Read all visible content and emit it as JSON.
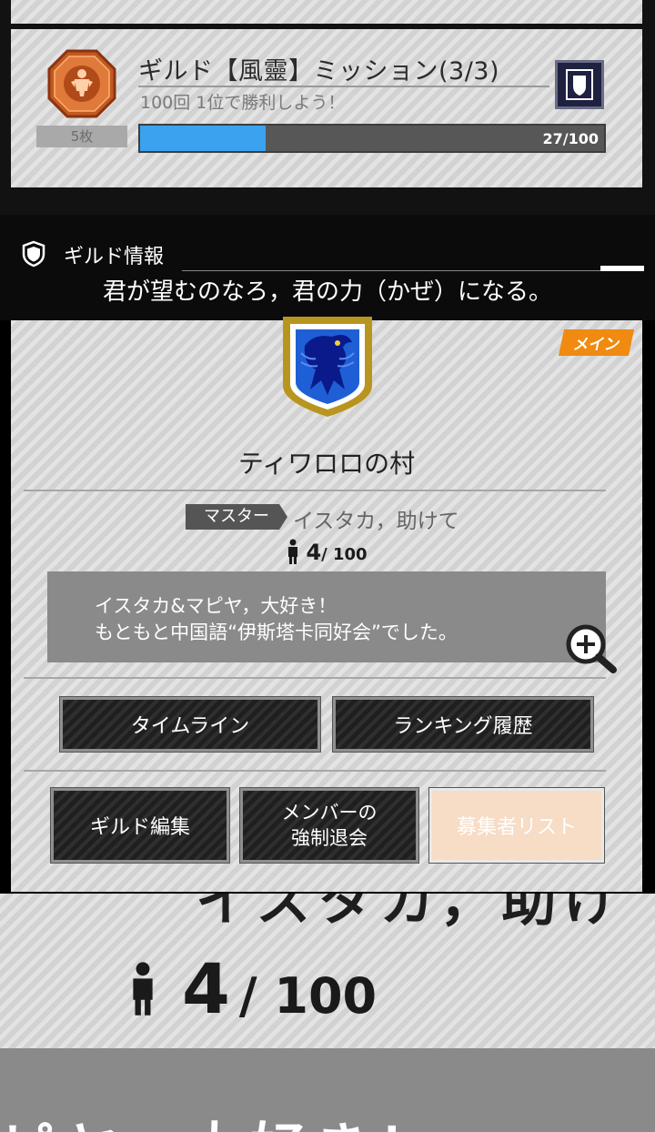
{
  "mission": {
    "title": "ギルド【風靈】ミッション(3/3)",
    "description": "100回 1位で勝利しよう！",
    "reward_count": "5枚",
    "progress_current": 27,
    "progress_max": 100,
    "progress_text": "27/100"
  },
  "header": {
    "title": "ギルド情報",
    "motto": "君が望むのなろ，君の力（かぜ）になる。"
  },
  "guild": {
    "badge": "メイン",
    "name": "ティワロロの村",
    "master_label": "マスター",
    "master_name": "イスタカ，助けて",
    "members_count": "4",
    "members_max": "/ 100",
    "description": "イスタカ&マピヤ，大好き！\nもともと中国語“伊斯塔卡同好会”でした。"
  },
  "buttons": {
    "timeline": "タイムライン",
    "ranking_history": "ランキング履歴",
    "guild_edit": "ギルド編集",
    "member_kick_line1": "メンバーの",
    "member_kick_line2": "強制退会",
    "recruit_list": "募集者リスト"
  },
  "zoom": {
    "ghost_top": "イスタカ，助け",
    "members_count": "4",
    "members_max": "/ 100",
    "ghost_bottom": "ピヤ，大好き！"
  },
  "colors": {
    "progress": "#3aa2ee",
    "badge": "#f08a10",
    "emblem_gold": "#b8951f",
    "emblem_blue": "#1f5fd6"
  },
  "icons": [
    "mission-medal-icon",
    "shield-icon",
    "guild-emblem-icon",
    "person-icon",
    "zoom-in-icon"
  ]
}
